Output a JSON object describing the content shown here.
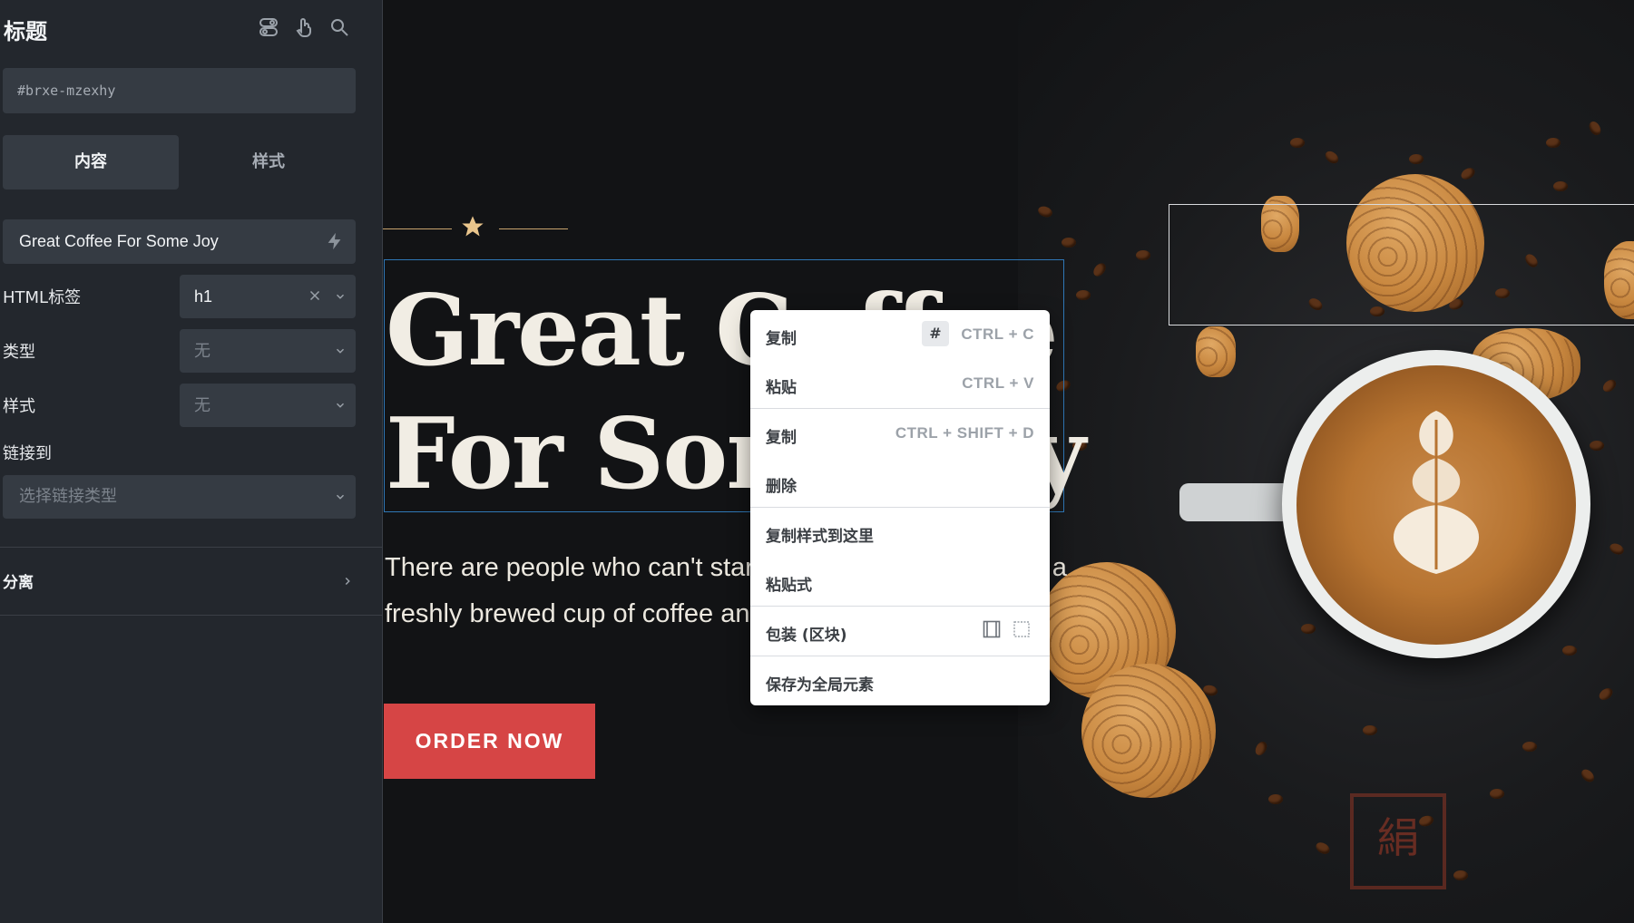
{
  "sidebar": {
    "title": "标题",
    "header_icons": [
      "toggle-icon",
      "pointer-hand-icon",
      "search-icon"
    ],
    "element_id": "#brxe-mzexhy",
    "tabs": [
      {
        "label": "内容",
        "active": true
      },
      {
        "label": "样式",
        "active": false
      }
    ],
    "text_value": "Great Coffee For Some Joy",
    "fields": {
      "html_tag": {
        "label": "HTML标签",
        "value": "h1"
      },
      "type": {
        "label": "类型",
        "placeholder": "无"
      },
      "style": {
        "label": "样式",
        "placeholder": "无"
      },
      "link": {
        "label": "链接到",
        "placeholder": "选择链接类型"
      }
    },
    "section": {
      "label": "分离"
    }
  },
  "canvas": {
    "heading_line1": "Great Coffee",
    "heading_line2": "For Some Joy",
    "paragraph_line1": "There are people who can't start their day without having a",
    "paragraph_line2": "freshly brewed cup of coffee and we understand them.",
    "button_label": "ORDER NOW",
    "accent_color": "#c8a46e",
    "button_color": "#d64545",
    "selection_color": "#2f77b6"
  },
  "context_menu": {
    "items": [
      {
        "label": "复制",
        "badge": "#",
        "shortcut": "CTRL + C"
      },
      {
        "label": "粘贴",
        "shortcut": "CTRL + V"
      },
      {
        "label": "复制",
        "shortcut": "CTRL + SHIFT + D"
      },
      {
        "label": "删除"
      },
      {
        "label": "复制样式到这里"
      },
      {
        "label": "粘贴式"
      },
      {
        "label": "包装 (区块)"
      },
      {
        "label": "保存为全局元素"
      }
    ]
  }
}
